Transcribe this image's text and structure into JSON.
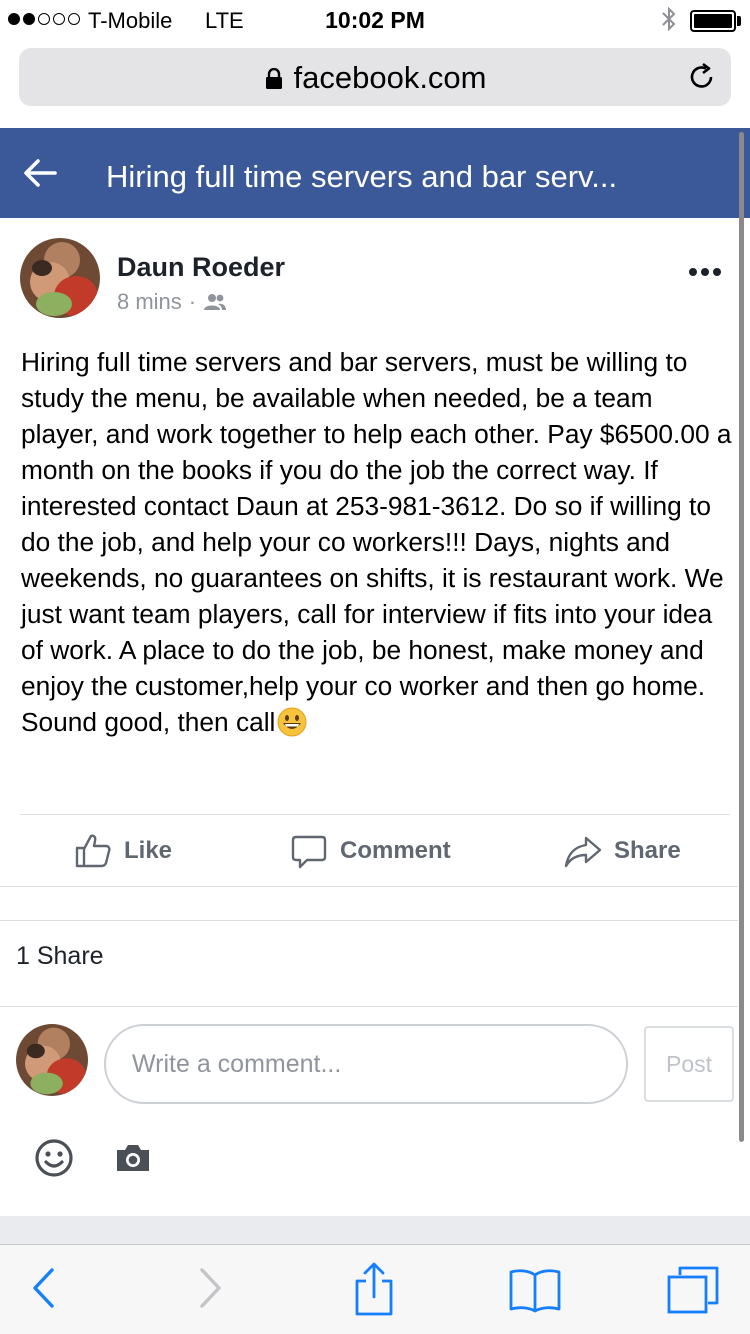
{
  "status_bar": {
    "carrier": "T-Mobile",
    "network": "LTE",
    "time": "10:02 PM",
    "signal_bars_filled": 2,
    "signal_bars_total": 5
  },
  "browser": {
    "url": "facebook.com"
  },
  "header": {
    "title": "Hiring full time servers and bar serv...",
    "color": "#3b5998"
  },
  "post": {
    "author": "Daun Roeder",
    "time_ago": "8 mins",
    "separator": "·",
    "audience_icon": "friends-icon",
    "text": "Hiring full time servers and bar servers, must be willing to study the menu, be available when needed, be a team player, and work together to help each other. Pay $6500.00 a month on the books if you do the job the correct way. If interested contact Daun at 253-981-3612. Do so if willing to do the job, and help your co workers!!! Days, nights and weekends, no guarantees on shifts, it is restaurant work. We just want team players, call for interview if fits into your idea of work. A place to do the job, be honest, make money and enjoy the customer,help your co worker and then go home. Sound good, then call",
    "emoji": "grinning-face"
  },
  "actions": {
    "like": "Like",
    "comment": "Comment",
    "share": "Share"
  },
  "shares_count": "1 Share",
  "comment_box": {
    "placeholder": "Write a comment...",
    "post_button": "Post"
  },
  "toolbar": {
    "icons": [
      "back-icon",
      "forward-icon",
      "share-icon",
      "bookmarks-icon",
      "tabs-icon"
    ],
    "tint": "#147efb"
  }
}
